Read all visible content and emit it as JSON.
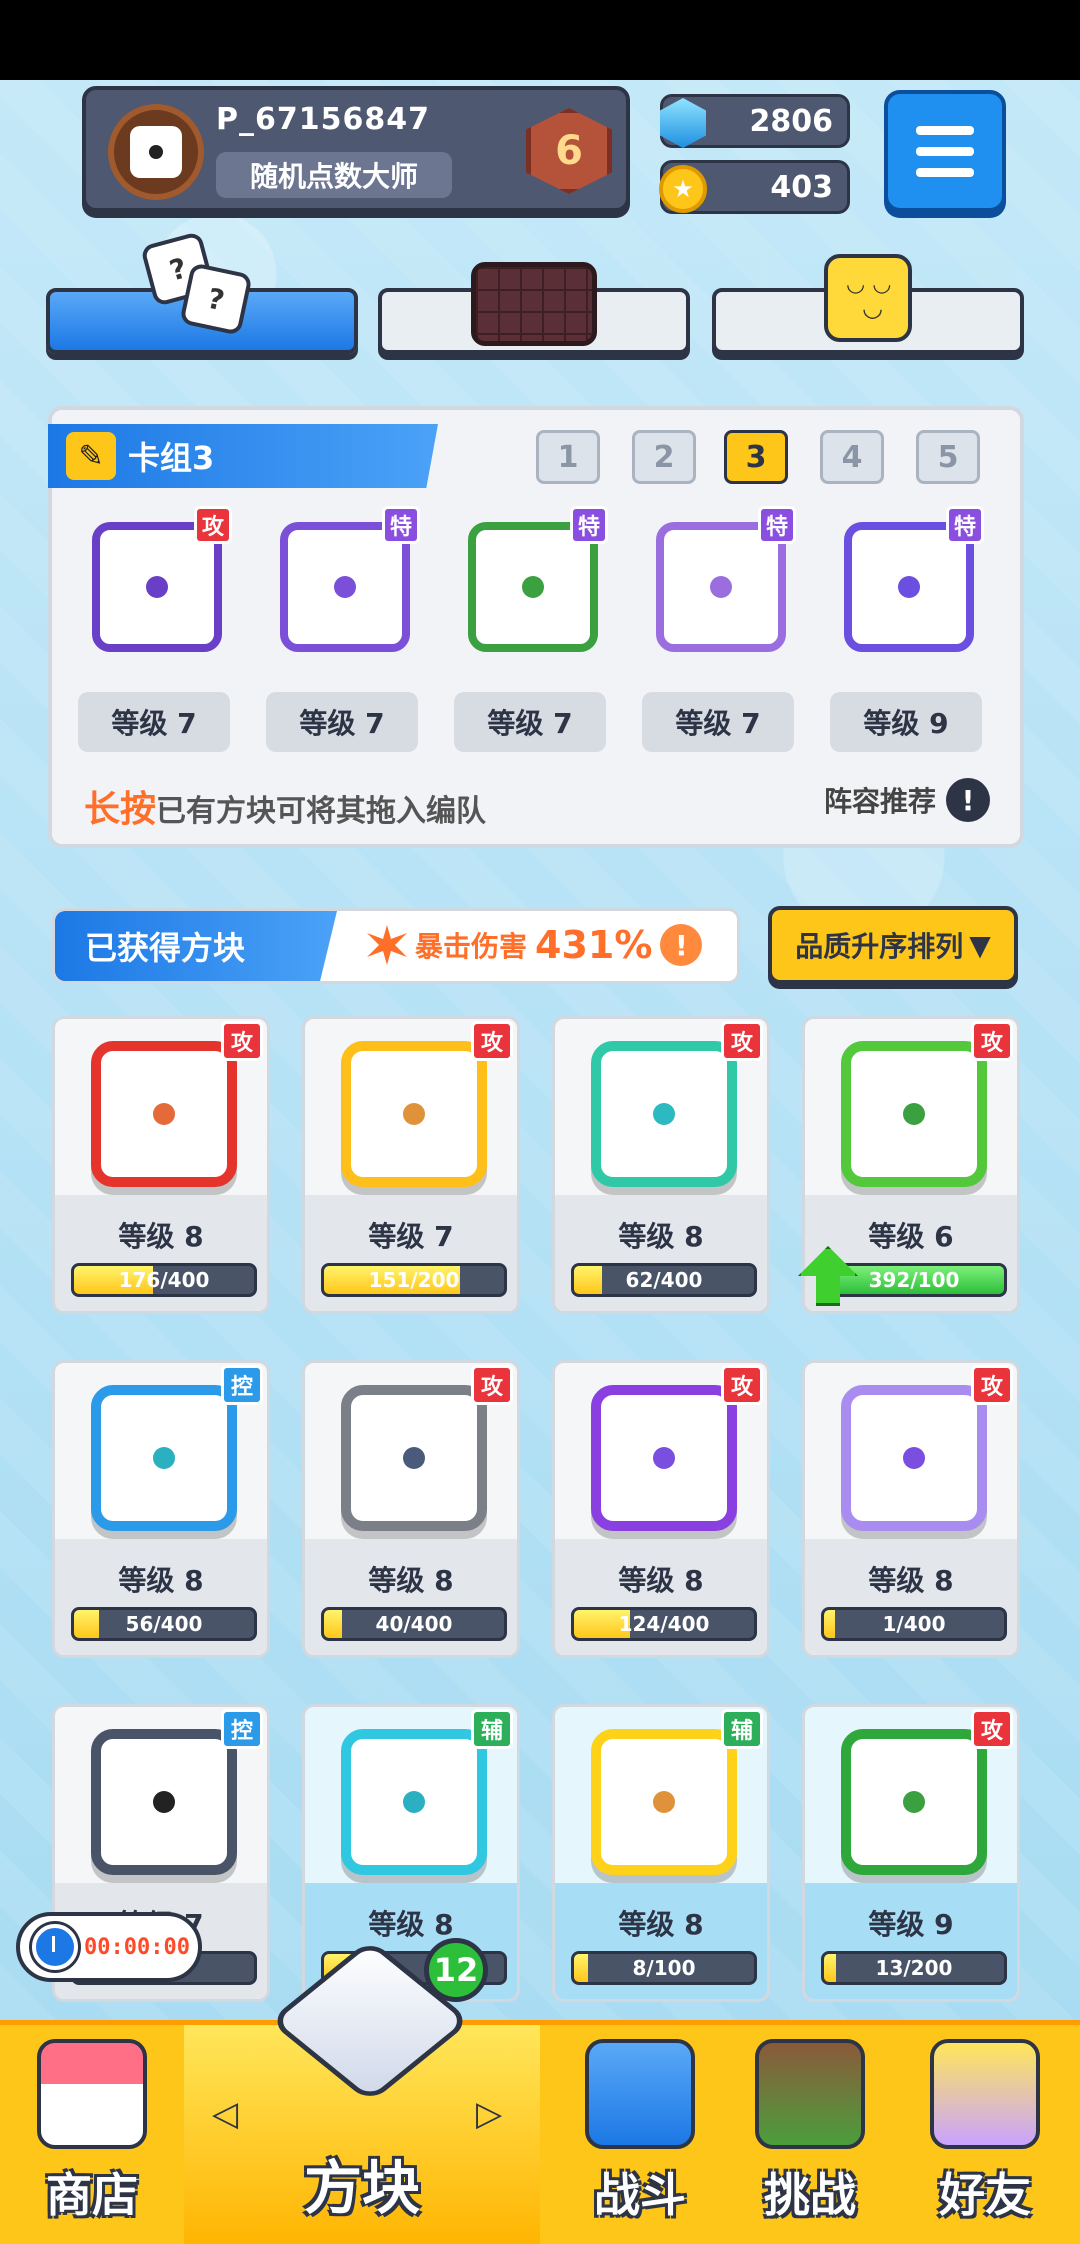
{
  "colors": {
    "accent_blue": "#1c78e5",
    "accent_yellow": "#ffc61a",
    "attack_tag": "#e8343a",
    "special_tag": "#8a4fe0",
    "control_tag": "#2b9ae8",
    "support_tag": "#2dae5a",
    "dark": "#2d3446"
  },
  "profile": {
    "player_name": "P_67156847",
    "title": "随机点数大师",
    "rank": "6"
  },
  "currency": {
    "gems": "2806",
    "coins": "403"
  },
  "deck": {
    "title": "卡组3",
    "tabs": [
      "1",
      "2",
      "3",
      "4",
      "5"
    ],
    "active_tab": "3",
    "cards": [
      {
        "tag": "攻",
        "level": "等级 7",
        "frame_color": "#6a3fc8",
        "tag_color": "#e8343a"
      },
      {
        "tag": "特",
        "level": "等级 7",
        "frame_color": "#7b4fd8",
        "tag_color": "#8a4fe0"
      },
      {
        "tag": "特",
        "level": "等级 7",
        "frame_color": "#3aa040",
        "tag_color": "#8a4fe0"
      },
      {
        "tag": "特",
        "level": "等级 7",
        "frame_color": "#9b6ee0",
        "tag_color": "#8a4fe0"
      },
      {
        "tag": "特",
        "level": "等级 9",
        "frame_color": "#6a4fe0",
        "tag_color": "#8a4fe0"
      }
    ],
    "hint_highlight": "长按",
    "hint_text": "已有方块可将其拖入编队",
    "recommend": "阵容推荐"
  },
  "obtained": {
    "label": "已获得方块",
    "crit_label": "暴击伤害",
    "crit_value": "431%",
    "sort_label": "品质升序排列"
  },
  "cards": [
    {
      "tag": "攻",
      "level": "等级 8",
      "progress_text": "176/400",
      "progress": 0.44,
      "frame": "#e5342c",
      "dot": "#e46a3a",
      "tag_color": "#e8343a"
    },
    {
      "tag": "攻",
      "level": "等级 7",
      "progress_text": "151/200",
      "progress": 0.755,
      "frame": "#ffbf1a",
      "dot": "#e0923a",
      "tag_color": "#e8343a"
    },
    {
      "tag": "攻",
      "level": "等级 8",
      "progress_text": "62/400",
      "progress": 0.155,
      "frame": "#2fc9a8",
      "dot": "#2cb9c0",
      "tag_color": "#e8343a"
    },
    {
      "tag": "攻",
      "level": "等级 6",
      "progress_text": "392/100",
      "progress": 1.0,
      "frame": "#52c83a",
      "dot": "#3aa040",
      "tag_color": "#e8343a"
    },
    {
      "tag": "控",
      "level": "等级 8",
      "progress_text": "56/400",
      "progress": 0.14,
      "frame": "#2b9ae8",
      "dot": "#2ab0c0",
      "tag_color": "#2b9ae8"
    },
    {
      "tag": "攻",
      "level": "等级 8",
      "progress_text": "40/400",
      "progress": 0.1,
      "frame": "#7a7f88",
      "dot": "#4a5a7a",
      "tag_color": "#e8343a"
    },
    {
      "tag": "攻",
      "level": "等级 8",
      "progress_text": "124/400",
      "progress": 0.31,
      "frame": "#8a3fe0",
      "dot": "#7a4fe0",
      "tag_color": "#e8343a"
    },
    {
      "tag": "攻",
      "level": "等级 8",
      "progress_text": "1/400",
      "progress": 0.0025,
      "frame": "#a98cf0",
      "dot": "#7a4fe0",
      "tag_color": "#e8343a"
    },
    {
      "tag": "控",
      "level": "等级 7",
      "progress_text": "",
      "progress": 0.3,
      "frame": "#4a5468",
      "dot": "#222",
      "tag_color": "#2b9ae8"
    },
    {
      "tag": "辅",
      "level": "等级 8",
      "progress_text": "",
      "progress": 0.3,
      "frame": "#30c8e0",
      "dot": "#2ab0c0",
      "tag_color": "#2dae5a"
    },
    {
      "tag": "辅",
      "level": "等级 8",
      "progress_text": "8/100",
      "progress": 0.08,
      "frame": "#ffd21a",
      "dot": "#e0923a",
      "tag_color": "#2dae5a"
    },
    {
      "tag": "攻",
      "level": "等级 9",
      "progress_text": "13/200",
      "progress": 0.065,
      "frame": "#2ea83a",
      "dot": "#3aa040",
      "tag_color": "#e8343a"
    }
  ],
  "timer": "00:00:00",
  "nav": {
    "shop": "商店",
    "cubes": "方块",
    "cubes_badge": "12",
    "battle": "战斗",
    "challenge": "挑战",
    "friends": "好友"
  }
}
